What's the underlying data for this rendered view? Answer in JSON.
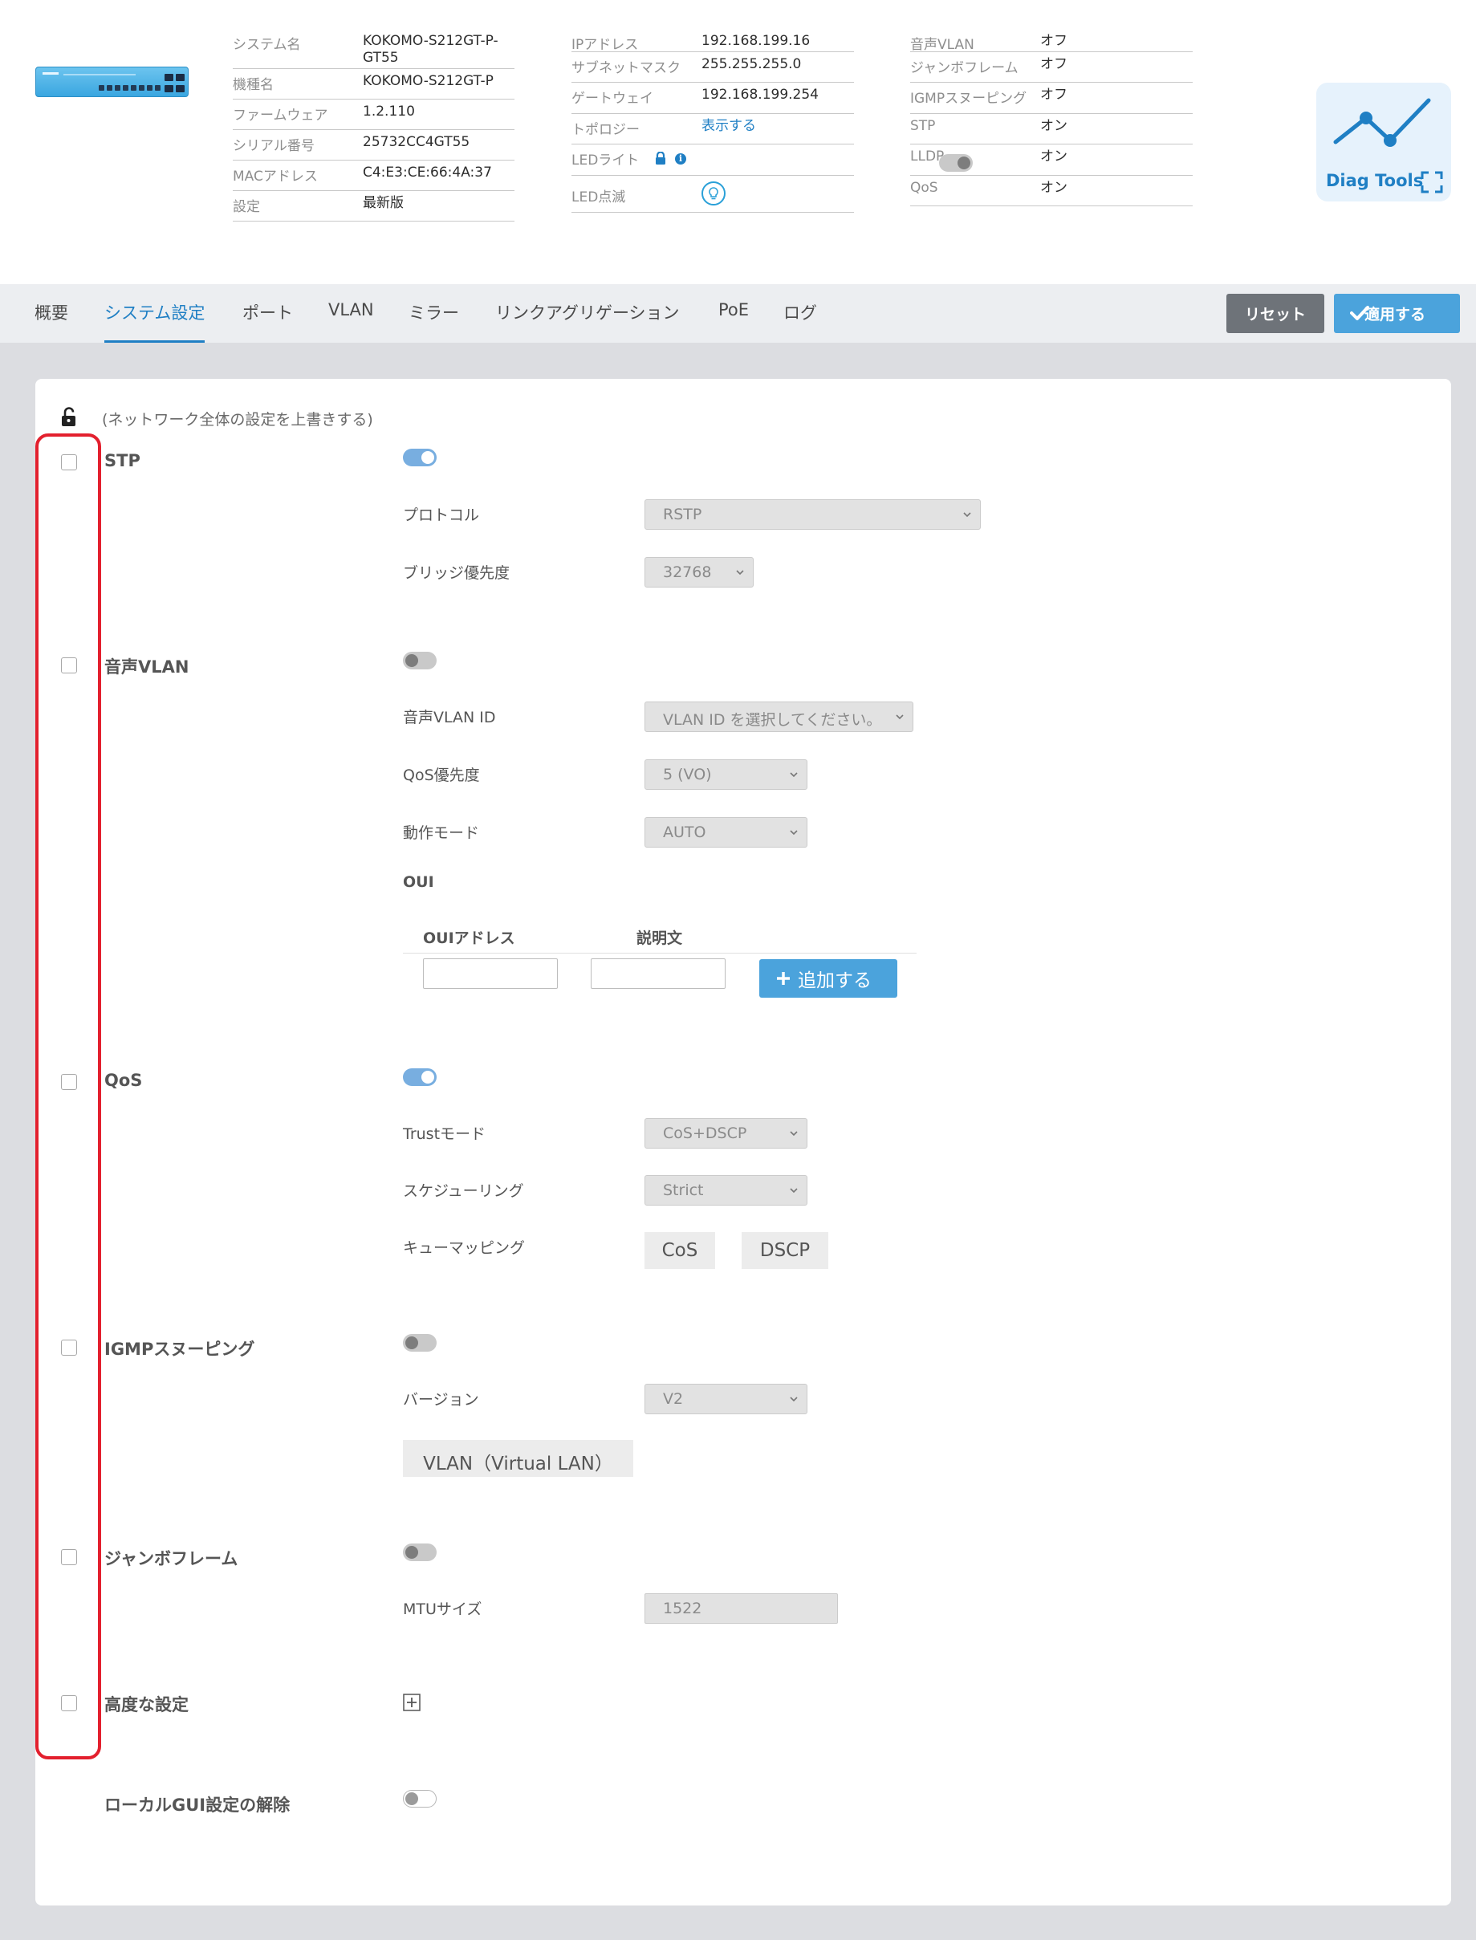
{
  "device_info": {
    "col1": [
      {
        "key": "システム名",
        "value": "KOKOMO-S212GT-P-GT55"
      },
      {
        "key": "機種名",
        "value": "KOKOMO-S212GT-P"
      },
      {
        "key": "ファームウェア",
        "value": "1.2.110"
      },
      {
        "key": "シリアル番号",
        "value": "25732CC4GT55"
      },
      {
        "key": "MACアドレス",
        "value": "C4:E3:CE:66:4A:37"
      },
      {
        "key": "設定",
        "value": "最新版"
      }
    ],
    "col2": [
      {
        "key": "IPアドレス",
        "value": "192.168.199.16"
      },
      {
        "key": "サブネットマスク",
        "value": "255.255.255.0"
      },
      {
        "key": "ゲートウェイ",
        "value": "192.168.199.254"
      },
      {
        "key": "トポロジー",
        "value": "表示する"
      },
      {
        "key": "LEDライト",
        "state": "off"
      },
      {
        "key": "LED点滅"
      }
    ],
    "col3": [
      {
        "key": "音声VLAN",
        "value": "オフ"
      },
      {
        "key": "ジャンボフレーム",
        "value": "オフ"
      },
      {
        "key": "IGMPスヌーピング",
        "value": "オフ"
      },
      {
        "key": "STP",
        "value": "オン"
      },
      {
        "key": "LLDP",
        "value": "オン"
      },
      {
        "key": "QoS",
        "value": "オン"
      }
    ]
  },
  "diag_tools": {
    "label": "Diag Tools",
    "accent": "#1f7fc4"
  },
  "tabs": [
    {
      "label": "概要"
    },
    {
      "label": "システム設定",
      "active": true
    },
    {
      "label": "ポート"
    },
    {
      "label": "VLAN"
    },
    {
      "label": "ミラー"
    },
    {
      "label": "リンクアグリゲーション"
    },
    {
      "label": "PoE"
    },
    {
      "label": "ログ"
    }
  ],
  "actions": {
    "reset": "リセット",
    "apply": "適用する"
  },
  "override_note": "(ネットワーク全体の設定を上書きする)",
  "sections": {
    "stp": {
      "title": "STP",
      "enabled": true,
      "checked": false,
      "protocol_label": "プロトコル",
      "protocol_value": "RSTP",
      "priority_label": "ブリッジ優先度",
      "priority_value": "32768"
    },
    "voice_vlan": {
      "title": "音声VLAN",
      "enabled": false,
      "checked": false,
      "vlan_id_label": "音声VLAN ID",
      "vlan_id_placeholder": "VLAN ID を選択してください。",
      "qos_label": "QoS優先度",
      "qos_value": "5 (VO)",
      "mode_label": "動作モード",
      "mode_value": "AUTO",
      "oui_label": "OUI",
      "oui_address_header": "OUIアドレス",
      "oui_desc_header": "説明文",
      "oui_address_value": "",
      "oui_desc_value": "",
      "add_label": "追加する"
    },
    "qos": {
      "title": "QoS",
      "enabled": true,
      "checked": false,
      "trust_label": "Trustモード",
      "trust_value": "CoS+DSCP",
      "sched_label": "スケジューリング",
      "sched_value": "Strict",
      "queue_label": "キューマッピング",
      "queue_buttons": [
        "CoS",
        "DSCP"
      ]
    },
    "igmp": {
      "title": "IGMPスヌーピング",
      "enabled": false,
      "checked": false,
      "version_label": "バージョン",
      "version_value": "V2",
      "vlan_button": "VLAN（Virtual LAN）"
    },
    "jumbo": {
      "title": "ジャンボフレーム",
      "enabled": false,
      "checked": false,
      "mtu_label": "MTUサイズ",
      "mtu_value": "1522"
    },
    "advanced": {
      "title": "高度な設定",
      "checked": false
    },
    "local_gui": {
      "title": "ローカルGUI設定の解除",
      "enabled": false
    }
  },
  "colors": {
    "accent": "#1f7fc4",
    "highlight_frame": "#e3202e",
    "toggle_on": "#78aee0"
  }
}
